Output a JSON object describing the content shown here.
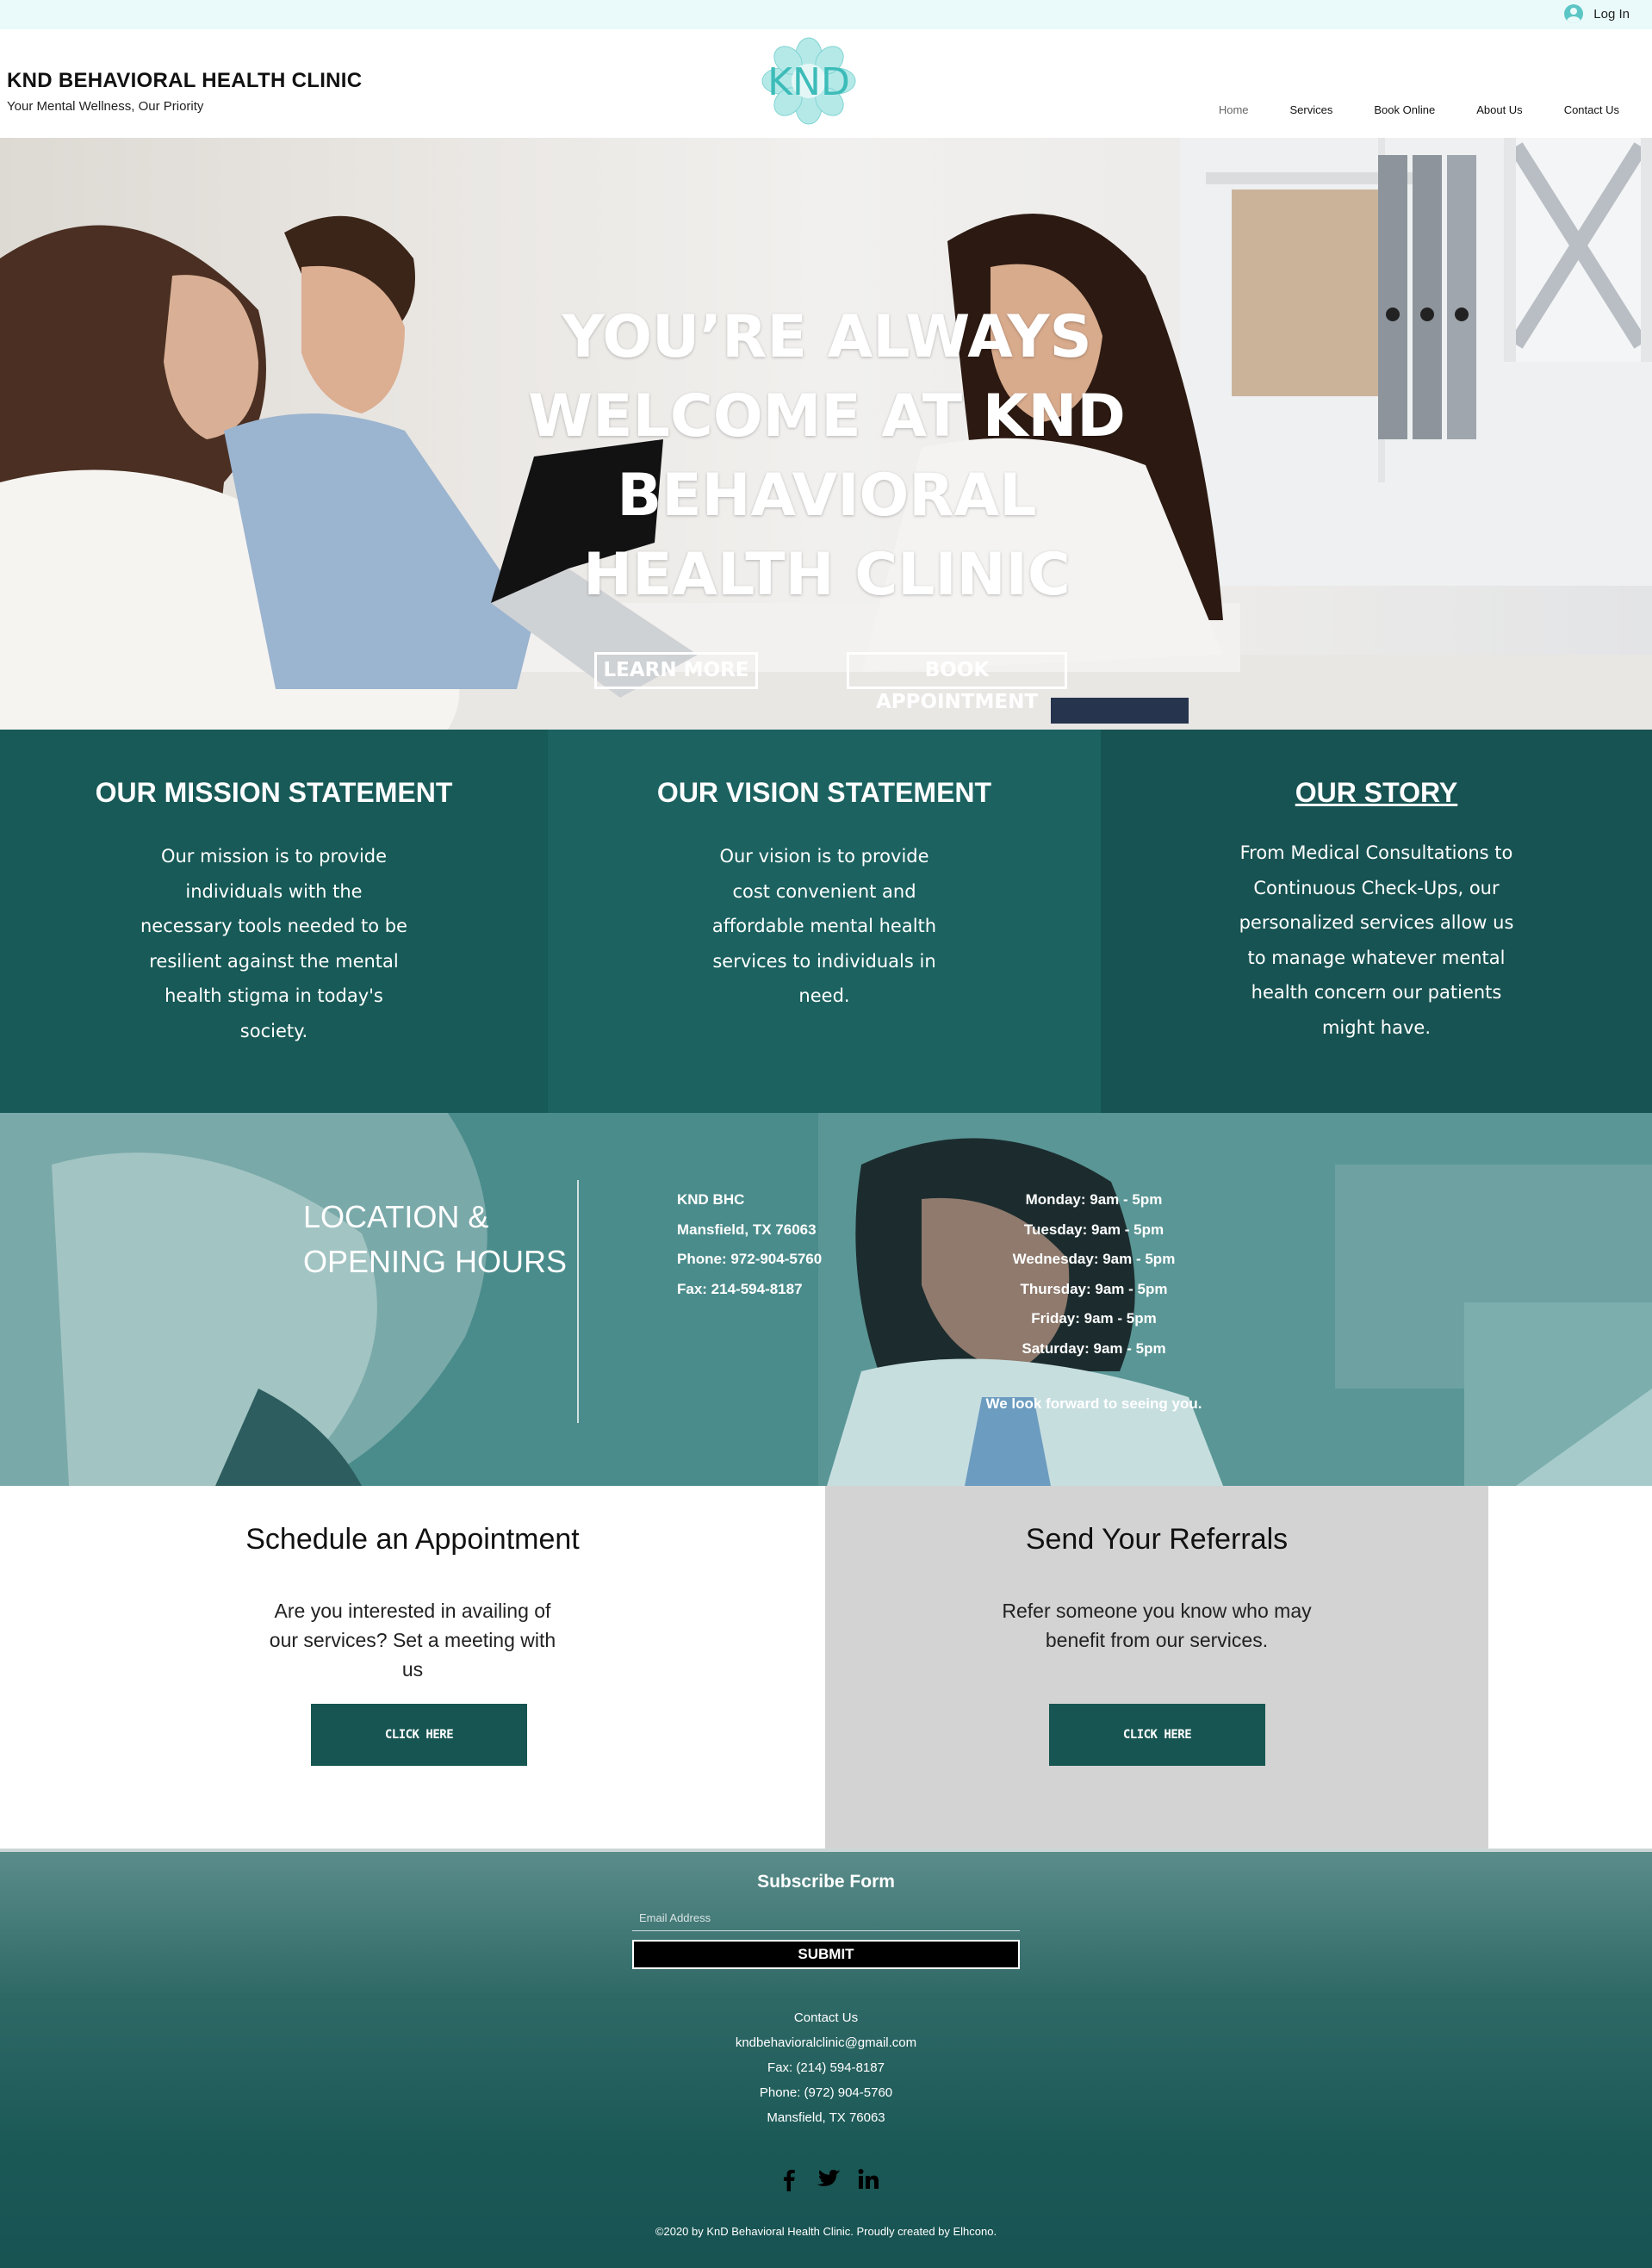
{
  "topbar": {
    "login_label": "Log In"
  },
  "header": {
    "title": "KND BEHAVIORAL HEALTH CLINIC",
    "tagline": "Your Mental Wellness, Our Priority",
    "logo_text": "KND",
    "nav": [
      {
        "label": "Home",
        "active": true
      },
      {
        "label": "Services"
      },
      {
        "label": "Book Online"
      },
      {
        "label": "About Us"
      },
      {
        "label": "Contact Us"
      }
    ]
  },
  "hero": {
    "title": "YOU’RE ALWAYS WELCOME AT KND BEHAVIORAL HEALTH CLINIC",
    "learn_more": "LEARN MORE",
    "book_appointment": "BOOK APPOINTMENT"
  },
  "statements": {
    "mission": {
      "title": "OUR MISSION STATEMENT",
      "text": "Our mission is to provide individuals with the necessary tools needed to be resilient against the mental health stigma in today's society."
    },
    "vision": {
      "title": "OUR VISION STATEMENT",
      "text": "Our vision is to provide cost convenient and affordable mental health services to individuals in need."
    },
    "story": {
      "title": "OUR STORY",
      "text": "From Medical Consultations to Continuous Check-Ups, our personalized services allow us to manage whatever mental health concern our patients might have."
    }
  },
  "location": {
    "title_line1": "LOCATION &",
    "title_line2": "OPENING HOURS",
    "address": [
      "KND BHC",
      "Mansfield, TX 76063",
      "Phone: 972-904-5760",
      "Fax: 214-594-8187"
    ],
    "hours": [
      "Monday: 9am - 5pm",
      "Tuesday: 9am - 5pm",
      "Wednesday: 9am - 5pm",
      "Thursday: 9am - 5pm",
      "Friday: 9am - 5pm",
      "Saturday: 9am - 5pm"
    ],
    "closing": "We look forward to seeing you."
  },
  "appointment": {
    "title": "Schedule an Appointment",
    "text": "Are you interested in availing of our services? Set a meeting with us",
    "button": "CLICK HERE"
  },
  "referrals": {
    "title": "Send Your Referrals",
    "text": "Refer someone you know who may benefit from our services.",
    "button": "CLICK HERE"
  },
  "footer": {
    "subscribe_title": "Subscribe Form",
    "email_placeholder": "Email Address",
    "submit": "SUBMIT",
    "contact_heading": "Contact Us",
    "email": "kndbehavioralclinic@gmail.com",
    "fax": "Fax: (214) 594-8187",
    "phone": "Phone: (972) 904-5760",
    "city": "Mansfield, TX 76063",
    "socials": [
      "facebook-icon",
      "twitter-icon",
      "linkedin-icon"
    ],
    "copyright": "©2020 by KnD Behavioral Health Clinic. Proudly created by Elhcono."
  },
  "colors": {
    "brand_teal": "#175552",
    "logo_teal": "#5cc9c6",
    "topbar_bg": "#eafafa",
    "referral_bg": "#d3d3d3"
  }
}
